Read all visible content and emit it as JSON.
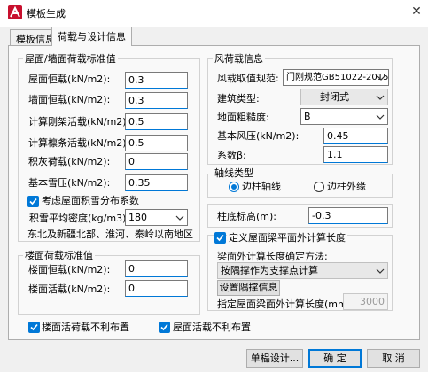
{
  "window": {
    "title": "模板生成",
    "close_glyph": "✕",
    "icon": "autocad-app-icon"
  },
  "tabs": [
    {
      "label": "模板信息",
      "active": false
    },
    {
      "label": "荷载与设计信息",
      "active": true
    }
  ],
  "roof_wall_loads": {
    "title": "屋面/墙面荷载标准值",
    "fields": [
      {
        "label": "屋面恒载(kN/m2):",
        "value": "0.3"
      },
      {
        "label": "墙面恒载(kN/m2):",
        "value": "0.3"
      },
      {
        "label": "计算刚架活载(kN/m2):",
        "value": "0.5"
      },
      {
        "label": "计算檩条活载(kN/m2):",
        "value": "0.5"
      },
      {
        "label": "积灰荷载(kN/m2):",
        "value": "0"
      },
      {
        "label": "基本雪压(kN/m2):",
        "value": "0.35"
      }
    ],
    "snow_checkbox": {
      "label": "考虑屋面积雪分布系数",
      "checked": true
    },
    "density_label": "积雪平均密度(kg/m3):",
    "density_value": "180",
    "region_text": "东北及新疆北部、淮河、秦岭以南地区"
  },
  "floor_loads": {
    "title": "楼面荷载标准值",
    "fields": [
      {
        "label": "楼面恒载(kN/m2):",
        "value": "0"
      },
      {
        "label": "楼面活载(kN/m2):",
        "value": "0"
      }
    ]
  },
  "wind_loads": {
    "title": "风荷载信息",
    "code_label": "风载取值规范:",
    "code_value": "门刚规范GB51022-2015",
    "building_type_label": "建筑类型:",
    "building_type_value": "封闭式",
    "roughness_label": "地面粗糙度:",
    "roughness_value": "B",
    "pressure_label": "基本风压(kN/m2):",
    "pressure_value": "0.45",
    "beta_label": "系数β:",
    "beta_value": "1.1"
  },
  "axis_type": {
    "title": "轴线类型",
    "options": [
      {
        "label": "边柱轴线",
        "selected": true
      },
      {
        "label": "边柱外缘",
        "selected": false
      }
    ]
  },
  "column_base": {
    "label": "柱底标高(m):",
    "value": "-0.3"
  },
  "beam_length": {
    "checkbox_label": "定义屋面梁平面外计算长度",
    "checked": true,
    "method_label": "梁面外计算长度确定方法:",
    "method_value": "按隅撑作为支撑点计算",
    "set_brace_button": "设置隅撑信息",
    "specified_label": "指定屋面梁面外计算长度(mm)",
    "specified_value": "3000"
  },
  "bottom_checks": [
    {
      "label": "楼面活荷载不利布置",
      "checked": true
    },
    {
      "label": "屋面活载不利布置",
      "checked": true
    }
  ],
  "buttons": {
    "single_design": "单榀设计...",
    "ok": "确 定",
    "cancel": "取 消"
  }
}
